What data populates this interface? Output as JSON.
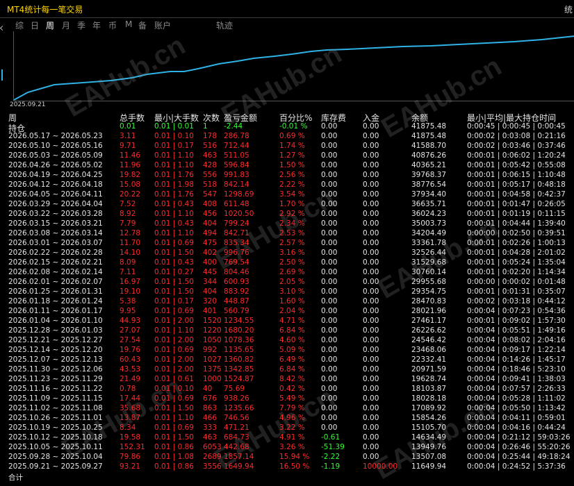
{
  "window": {
    "title": "MT4统计每一笔交易",
    "corner_glyph": "统"
  },
  "tabs": [
    "综",
    "日",
    "周",
    "月",
    "季",
    "年",
    "币",
    "M",
    "备",
    "账户",
    "轨迹"
  ],
  "active_tab": "周",
  "chart": {
    "start_date_label": "2025.09.21",
    "line_color": "#2fb3e6"
  },
  "watermark": "EAHub.cn",
  "columns": [
    "周",
    "总手数",
    "最小|大手数",
    "次数",
    "盈亏金额",
    "百分比%",
    "库存费",
    "入金",
    "余额",
    "最小|平均|最大持仓时间"
  ],
  "holding_row": {
    "label": "持仓",
    "lots": "0.01",
    "minmax": "0.01 | 0.01",
    "count": "1",
    "pnl": "-2.44",
    "pct": "-0.01 %",
    "swap": "0.00",
    "deposit": "0.00",
    "balance": "41875.48",
    "time": "0:00:45 | 0:00:45 | 0:00:45"
  },
  "rows": [
    {
      "period": "2026.05.17 ~ 2026.05.23",
      "lots": "3.11",
      "minmax": "0.01 | 0.10",
      "count": "178",
      "pnl": "286.78",
      "pct": "0.69 %",
      "swap": "0.00",
      "deposit": "0.00",
      "balance": "41875.48",
      "time": "0:00:02 | 0:03:08 | 0:21:16"
    },
    {
      "period": "2026.05.10 ~ 2026.05.16",
      "lots": "9.71",
      "minmax": "0.01 | 0.17",
      "count": "516",
      "pnl": "712.44",
      "pct": "1.74 %",
      "swap": "0.00",
      "deposit": "0.00",
      "balance": "41588.70",
      "time": "0:00:02 | 0:03:46 | 0:37:46"
    },
    {
      "period": "2026.05.03 ~ 2026.05.09",
      "lots": "11.46",
      "minmax": "0.01 | 1.10",
      "count": "463",
      "pnl": "511.05",
      "pct": "1.27 %",
      "swap": "0.00",
      "deposit": "0.00",
      "balance": "40876.26",
      "time": "0:00:01 | 0:06:02 | 1:20:24"
    },
    {
      "period": "2026.04.26 ~ 2026.05.02",
      "lots": "11.96",
      "minmax": "0.01 | 1.10",
      "count": "428",
      "pnl": "596.84",
      "pct": "1.50 %",
      "swap": "0.00",
      "deposit": "0.00",
      "balance": "40365.21",
      "time": "0:00:01 | 0:05:42 | 0:55:08"
    },
    {
      "period": "2026.04.19 ~ 2026.04.25",
      "lots": "19.82",
      "minmax": "0.01 | 1.76",
      "count": "556",
      "pnl": "991.83",
      "pct": "2.56 %",
      "swap": "0.00",
      "deposit": "0.00",
      "balance": "39768.37",
      "time": "0:00:01 | 0:06:15 | 1:10:48"
    },
    {
      "period": "2026.04.12 ~ 2026.04.18",
      "lots": "15.08",
      "minmax": "0.01 | 1.98",
      "count": "518",
      "pnl": "842.14",
      "pct": "2.22 %",
      "swap": "0.00",
      "deposit": "0.00",
      "balance": "38776.54",
      "time": "0:00:01 | 0:05:17 | 0:48:18"
    },
    {
      "period": "2026.04.05 ~ 2026.04.11",
      "lots": "20.22",
      "minmax": "0.01 | 1.76",
      "count": "547",
      "pnl": "1298.69",
      "pct": "3.54 %",
      "swap": "0.00",
      "deposit": "0.00",
      "balance": "37934.40",
      "time": "0:00:01 | 0:04:58 | 0:42:37"
    },
    {
      "period": "2026.03.29 ~ 2026.04.04",
      "lots": "7.52",
      "minmax": "0.01 | 0.43",
      "count": "408",
      "pnl": "611.48",
      "pct": "1.70 %",
      "swap": "0.00",
      "deposit": "0.00",
      "balance": "36635.71",
      "time": "0:00:01 | 0:01:47 | 0:26:05"
    },
    {
      "period": "2026.03.22 ~ 2026.03.28",
      "lots": "8.92",
      "minmax": "0.01 | 1.10",
      "count": "456",
      "pnl": "1020.50",
      "pct": "2.92 %",
      "swap": "0.00",
      "deposit": "0.00",
      "balance": "36024.23",
      "time": "0:00:01 | 0:01:19 | 0:11:15"
    },
    {
      "period": "2026.03.15 ~ 2026.03.21",
      "lots": "7.79",
      "minmax": "0.01 | 0.43",
      "count": "404",
      "pnl": "799.24",
      "pct": "2.34 %",
      "swap": "0.00",
      "deposit": "0.00",
      "balance": "35003.73",
      "time": "0:00:01 | 0:04:44 | 1:39:40"
    },
    {
      "period": "2026.03.08 ~ 2026.03.14",
      "lots": "12.78",
      "minmax": "0.01 | 1.10",
      "count": "494",
      "pnl": "842.71",
      "pct": "2.53 %",
      "swap": "0.00",
      "deposit": "0.00",
      "balance": "34204.49",
      "time": "0:00:00 | 0:02:50 | 0:39:51"
    },
    {
      "period": "2026.03.01 ~ 2026.03.07",
      "lots": "11.70",
      "minmax": "0.01 | 0.69",
      "count": "475",
      "pnl": "835.34",
      "pct": "2.57 %",
      "swap": "0.00",
      "deposit": "0.00",
      "balance": "33361.78",
      "time": "0:00:01 | 0:02:26 | 1:00:13"
    },
    {
      "period": "2026.02.22 ~ 2026.02.28",
      "lots": "14.10",
      "minmax": "0.01 | 1.50",
      "count": "402",
      "pnl": "996.76",
      "pct": "3.16 %",
      "swap": "0.00",
      "deposit": "0.00",
      "balance": "32526.44",
      "time": "0:00:01 | 0:04:28 | 2:01:02"
    },
    {
      "period": "2026.02.15 ~ 2026.02.21",
      "lots": "8.09",
      "minmax": "0.01 | 0.43",
      "count": "400",
      "pnl": "769.54",
      "pct": "2.50 %",
      "swap": "0.00",
      "deposit": "0.00",
      "balance": "31529.68",
      "time": "0:00:01 | 0:05:24 | 1:35:04"
    },
    {
      "period": "2026.02.08 ~ 2026.02.14",
      "lots": "7.11",
      "minmax": "0.01 | 0.27",
      "count": "445",
      "pnl": "804.46",
      "pct": "2.69 %",
      "swap": "0.00",
      "deposit": "0.00",
      "balance": "30760.14",
      "time": "0:00:01 | 0:02:20 | 1:14:34"
    },
    {
      "period": "2026.02.01 ~ 2026.02.07",
      "lots": "16.97",
      "minmax": "0.01 | 1.50",
      "count": "344",
      "pnl": "600.93",
      "pct": "2.05 %",
      "swap": "0.00",
      "deposit": "0.00",
      "balance": "29955.68",
      "time": "0:00:00 | 0:00:02 | 0:01:48"
    },
    {
      "period": "2026.01.25 ~ 2026.01.31",
      "lots": "19.10",
      "minmax": "0.01 | 1.50",
      "count": "404",
      "pnl": "883.92",
      "pct": "3.10 %",
      "swap": "0.00",
      "deposit": "0.00",
      "balance": "29354.75",
      "time": "0:00:01 | 0:01:31 | 0:35:07"
    },
    {
      "period": "2026.01.18 ~ 2026.01.24",
      "lots": "5.38",
      "minmax": "0.01 | 0.17",
      "count": "320",
      "pnl": "448.87",
      "pct": "1.60 %",
      "swap": "0.00",
      "deposit": "0.00",
      "balance": "28470.83",
      "time": "0:00:02 | 0:03:18 | 0:44:12"
    },
    {
      "period": "2026.01.11 ~ 2026.01.17",
      "lots": "9.95",
      "minmax": "0.01 | 0.69",
      "count": "401",
      "pnl": "560.79",
      "pct": "2.04 %",
      "swap": "0.00",
      "deposit": "0.00",
      "balance": "28021.96",
      "time": "0:00:04 | 0:07:23 | 0:54:36"
    },
    {
      "period": "2026.01.04 ~ 2026.01.10",
      "lots": "44.93",
      "minmax": "0.01 | 2.00",
      "count": "1520",
      "pnl": "1234.55",
      "pct": "4.71 %",
      "swap": "0.00",
      "deposit": "0.00",
      "balance": "27461.17",
      "time": "0:00:01 | 0:09:02 | 1:57:30"
    },
    {
      "period": "2025.12.28 ~ 2026.01.03",
      "lots": "27.07",
      "minmax": "0.01 | 1.10",
      "count": "1220",
      "pnl": "1680.20",
      "pct": "6.84 %",
      "swap": "0.00",
      "deposit": "0.00",
      "balance": "26226.62",
      "time": "0:00:04 | 0:05:51 | 1:49:16"
    },
    {
      "period": "2025.12.21 ~ 2025.12.27",
      "lots": "27.54",
      "minmax": "0.01 | 2.00",
      "count": "1050",
      "pnl": "1078.36",
      "pct": "4.60 %",
      "swap": "0.00",
      "deposit": "0.00",
      "balance": "24546.42",
      "time": "0:00:04 | 0:08:02 | 2:04:16"
    },
    {
      "period": "2025.12.14 ~ 2025.12.20",
      "lots": "19.76",
      "minmax": "0.01 | 0.69",
      "count": "992",
      "pnl": "1135.65",
      "pct": "5.09 %",
      "swap": "0.00",
      "deposit": "0.00",
      "balance": "23468.06",
      "time": "0:00:04 | 0:09:17 | 1:22:14"
    },
    {
      "period": "2025.12.07 ~ 2025.12.13",
      "lots": "60.43",
      "minmax": "0.01 | 2.00",
      "count": "1027",
      "pnl": "1360.82",
      "pct": "6.49 %",
      "swap": "0.00",
      "deposit": "0.00",
      "balance": "22332.41",
      "time": "0:00:04 | 0:14:26 | 1:45:17"
    },
    {
      "period": "2025.11.30 ~ 2025.12.06",
      "lots": "43.53",
      "minmax": "0.01 | 2.00",
      "count": "1375",
      "pnl": "1342.85",
      "pct": "6.84 %",
      "swap": "0.00",
      "deposit": "0.00",
      "balance": "20971.59",
      "time": "0:00:04 | 0:18:46 | 5:23:10"
    },
    {
      "period": "2025.11.23 ~ 2025.11.29",
      "lots": "21.49",
      "minmax": "0.01 | 0.61",
      "count": "1000",
      "pnl": "1524.87",
      "pct": "8.42 %",
      "swap": "0.00",
      "deposit": "0.00",
      "balance": "19628.74",
      "time": "0:00:04 | 0:09:41 | 1:38:03"
    },
    {
      "period": "2025.11.16 ~ 2025.11.22",
      "lots": "0.78",
      "minmax": "0.01 | 0.10",
      "count": "40",
      "pnl": "75.69",
      "pct": "0.42 %",
      "swap": "0.00",
      "deposit": "0.00",
      "balance": "18103.87",
      "time": "0:00:04 | 0:07:57 | 2:26:33"
    },
    {
      "period": "2025.11.09 ~ 2025.11.15",
      "lots": "17.44",
      "minmax": "0.01 | 0.69",
      "count": "676",
      "pnl": "938.26",
      "pct": "5.49 %",
      "swap": "0.00",
      "deposit": "0.00",
      "balance": "18028.18",
      "time": "0:00:04 | 0:05:28 | 1:11:02"
    },
    {
      "period": "2025.11.02 ~ 2025.11.08",
      "lots": "35.68",
      "minmax": "0.01 | 1.50",
      "count": "863",
      "pnl": "1235.66",
      "pct": "7.79 %",
      "swap": "0.00",
      "deposit": "0.00",
      "balance": "17089.92",
      "time": "0:00:04 | 0:05:50 | 1:13:42"
    },
    {
      "period": "2025.10.26 ~ 2025.11.01",
      "lots": "13.87",
      "minmax": "0.01 | 1.10",
      "count": "466",
      "pnl": "746.56",
      "pct": "4.96 %",
      "swap": "0.00",
      "deposit": "0.00",
      "balance": "15854.26",
      "time": "0:00:04 | 0:04:11 | 0:59:01"
    },
    {
      "period": "2025.10.19 ~ 2025.10.25",
      "lots": "8.34",
      "minmax": "0.01 | 0.69",
      "count": "333",
      "pnl": "471.21",
      "pct": "3.22 %",
      "swap": "0.00",
      "deposit": "0.00",
      "balance": "15105.70",
      "time": "0:00:04 | 0:04:16 | 0:44:24"
    },
    {
      "period": "2025.10.12 ~ 2025.10.18",
      "lots": "19.58",
      "minmax": "0.01 | 1.50",
      "count": "463",
      "pnl": "684.73",
      "pct": "4.91 %",
      "swap": "-0.61",
      "deposit": "0.00",
      "balance": "14634.49",
      "time": "0:00:04 | 0:21:12 | 59:03:26"
    },
    {
      "period": "2025.10.05 ~ 2025.10.11",
      "lots": "152.31",
      "minmax": "0.01 | 0.86",
      "count": "6053",
      "pnl": "442.68",
      "pct": "3.26 %",
      "swap": "-51.39",
      "deposit": "0.00",
      "balance": "13949.76",
      "time": "0:00:04 | 0:26:46 | 55:20:26"
    },
    {
      "period": "2025.09.28 ~ 2025.10.04",
      "lots": "79.86",
      "minmax": "0.01 | 1.08",
      "count": "2689",
      "pnl": "1857.14",
      "pct": "15.94 %",
      "swap": "-2.22",
      "deposit": "0.00",
      "balance": "13507.08",
      "time": "0:00:04 | 0:25:44 | 49:18:24"
    },
    {
      "period": "2025.09.21 ~ 2025.09.27",
      "lots": "93.21",
      "minmax": "0.01 | 0.86",
      "count": "3556",
      "pnl": "1649.94",
      "pct": "16.50 %",
      "swap": "-1.19",
      "deposit": "10000.00",
      "balance": "11649.94",
      "time": "0:00:04 | 0:24:52 | 5:37:36"
    }
  ],
  "total_row": {
    "label": "合计"
  }
}
